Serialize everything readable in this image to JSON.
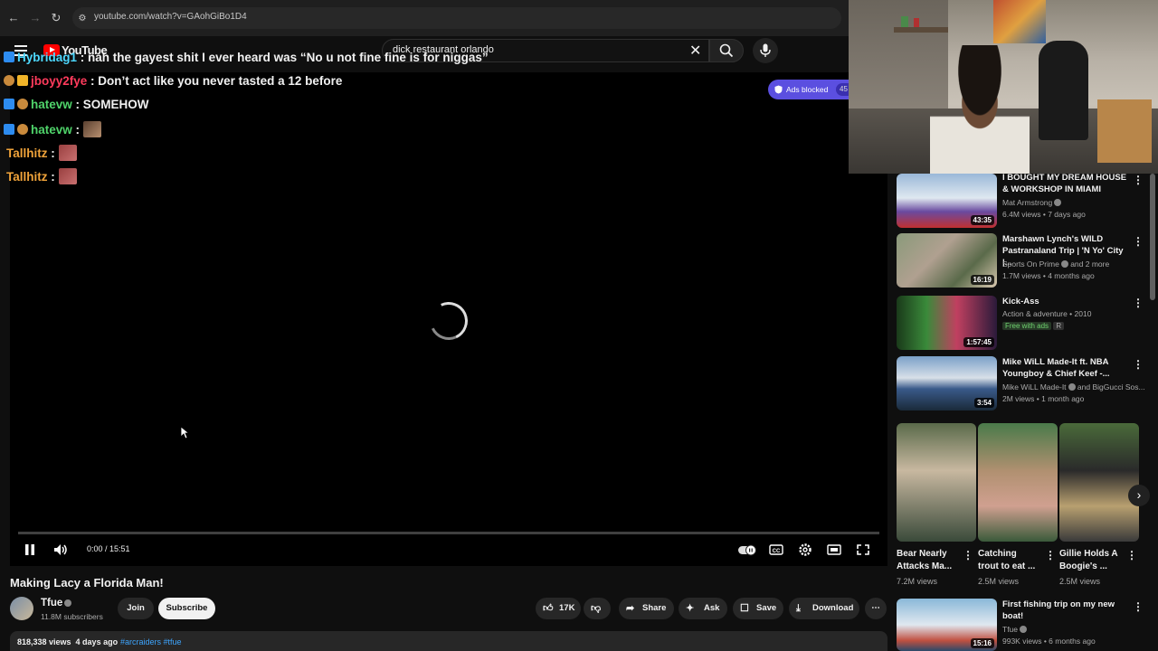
{
  "browser": {
    "url": "youtube.com/watch?v=GAohGiBo1D4"
  },
  "masthead": {
    "logo_text": "YouTube",
    "search_value": "dick restaurant orlando"
  },
  "chat": [
    {
      "user": "Hybridag1",
      "user_color": "#4dd8ff",
      "message": ": nah the gayest shit I ever heard was “No u not fine fine is for niggas”"
    },
    {
      "user": "jboyy2fye",
      "user_color": "#ff3b5c",
      "message": ": Don’t act like you never tasted a 12 before"
    },
    {
      "user": "hatevw",
      "user_color": "#4fd36a",
      "message": ": SOMEHOW"
    },
    {
      "user": "hatevw",
      "user_color": "#4fd36a",
      "message": ":"
    },
    {
      "user": "Tallhitz",
      "user_color": "#f0a33a",
      "message": ":"
    },
    {
      "user": "Tallhitz",
      "user_color": "#f0a33a",
      "message": ":"
    }
  ],
  "ads_blocked": {
    "label": "Ads blocked",
    "count": "45"
  },
  "player": {
    "time": "0:00 / 15:51",
    "state": "loading"
  },
  "video": {
    "title": "Making Lacy a Florida Man!",
    "channel": "Tfue",
    "subscribers": "11.8M subscribers",
    "join_label": "Join",
    "subscribe_label": "Subscribe",
    "likes": "17K",
    "share_label": "Share",
    "ask_label": "Ask",
    "save_label": "Save",
    "download_label": "Download",
    "views_date": "818,338 views  4 days ago",
    "tags": "#arcraiders #tfue"
  },
  "recommendations": [
    {
      "title": "I BOUGHT MY DREAM HOUSE & WORKSHOP IN MIAMI",
      "channel": "Mat Armstrong",
      "meta": "6.4M views • 7 days ago",
      "duration": "43:35"
    },
    {
      "title": "Marshawn Lynch's WILD Pastranaland Trip | 'N Yo' City |...",
      "channel": "Sports On Prime",
      "channel_extra": "and 2 more",
      "meta": "1.7M views • 4 months ago",
      "duration": "16:19"
    },
    {
      "title": "Kick-Ass",
      "channel": "Action & adventure • 2010",
      "badge": "Free with ads",
      "rating": "R",
      "duration": "1:57:45"
    },
    {
      "title": "Mike WiLL Made-It ft. NBA Youngboy & Chief Keef -...",
      "channel": "Mike WiLL Made-It",
      "channel_extra": "and BigGucci Sos...",
      "meta": "2M views • 1 month ago",
      "duration": "3:54"
    }
  ],
  "shorts": [
    {
      "title": "Bear Nearly Attacks Ma...",
      "views": "7.2M views"
    },
    {
      "title": "Catching trout to eat ...",
      "views": "2.5M views"
    },
    {
      "title": "Gillie Holds A Boogie's ...",
      "views": "2.5M views"
    }
  ],
  "bottom_rec": {
    "title": "First fishing trip on my new boat!",
    "channel": "Tfue",
    "meta": "993K views • 6 months ago",
    "duration": "15:16"
  },
  "icons": [
    "back-icon",
    "forward-icon",
    "reload-icon",
    "site-info-icon",
    "menu-icon",
    "search-icon",
    "mic-icon",
    "clear-icon",
    "pause-icon",
    "volume-icon",
    "autoplay-toggle",
    "captions-icon",
    "settings-icon",
    "theater-icon",
    "fullscreen-icon",
    "like-icon",
    "dislike-icon",
    "share-icon",
    "ask-icon",
    "save-icon",
    "download-icon",
    "more-icon"
  ]
}
